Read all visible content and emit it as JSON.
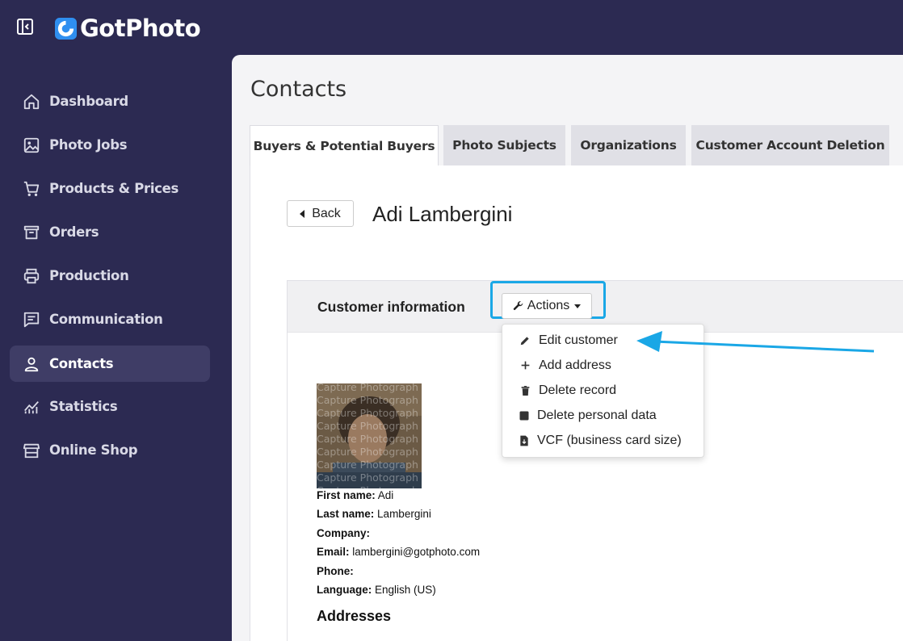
{
  "app": {
    "name": "GotPhoto"
  },
  "sidebar": {
    "items": [
      {
        "label": "Dashboard",
        "icon": "home-icon",
        "active": false
      },
      {
        "label": "Photo Jobs",
        "icon": "image-icon",
        "active": false
      },
      {
        "label": "Products & Prices",
        "icon": "cart-icon",
        "active": false
      },
      {
        "label": "Orders",
        "icon": "box-icon",
        "active": false
      },
      {
        "label": "Production",
        "icon": "printer-icon",
        "active": false
      },
      {
        "label": "Communication",
        "icon": "message-icon",
        "active": false
      },
      {
        "label": "Contacts",
        "icon": "user-icon",
        "active": true
      },
      {
        "label": "Statistics",
        "icon": "chart-icon",
        "active": false
      },
      {
        "label": "Online Shop",
        "icon": "store-icon",
        "active": false
      }
    ]
  },
  "page": {
    "title": "Contacts"
  },
  "tabs": [
    {
      "label": "Buyers & Potential Buyers",
      "active": true
    },
    {
      "label": "Photo Subjects",
      "active": false
    },
    {
      "label": "Organizations",
      "active": false
    },
    {
      "label": "Customer Account Deletion",
      "active": false
    }
  ],
  "detail": {
    "back_label": "Back",
    "customer_name": "Adi Lambergini",
    "section_title": "Customer information",
    "actions_label": "Actions",
    "actions_menu": [
      {
        "label": "Edit customer",
        "icon": "pencil-icon"
      },
      {
        "label": "Add address",
        "icon": "plus-icon"
      },
      {
        "label": "Delete record",
        "icon": "trash-icon"
      },
      {
        "label": "Delete personal data",
        "icon": "square-icon"
      },
      {
        "label": "VCF (business card size)",
        "icon": "file-download-icon"
      }
    ],
    "photo_watermark": "Capture Photograph",
    "fields": [
      {
        "label": "First name:",
        "value": "Adi"
      },
      {
        "label": "Last name:",
        "value": "Lambergini"
      },
      {
        "label": "Company:",
        "value": ""
      },
      {
        "label": "Email:",
        "value": "lambergini@gotphoto.com"
      },
      {
        "label": "Phone:",
        "value": ""
      },
      {
        "label": "Language:",
        "value": "English (US)"
      }
    ],
    "addresses_heading": "Addresses"
  },
  "colors": {
    "sidebar_bg": "#2c2a52",
    "accent_highlight": "#1aa7e6",
    "logo_blue": "#2f8ff0"
  }
}
